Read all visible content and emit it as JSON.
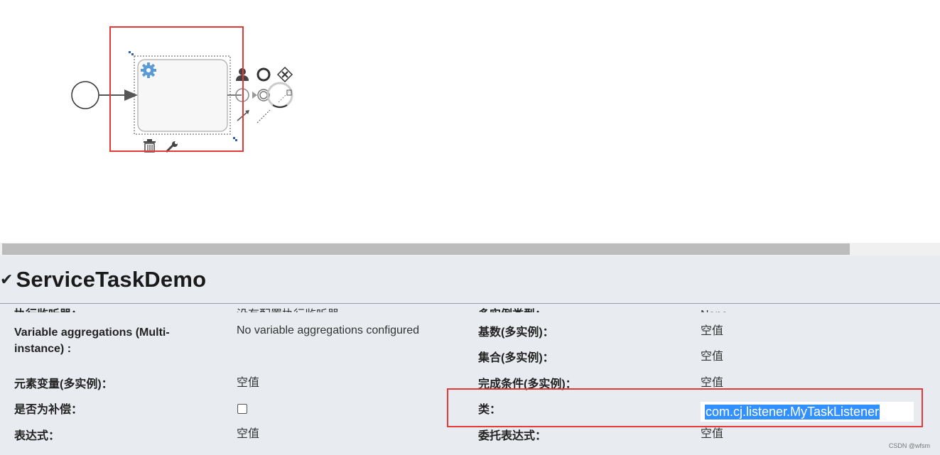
{
  "colors": {
    "highlight_box": "#e53935",
    "selection": "#3390ff",
    "gear": "#5b9bd5"
  },
  "diagram": {
    "icons": [
      "start-event-icon",
      "sequence-arrow-icon",
      "service-task-icon",
      "gear-icon",
      "user-task-icon",
      "end-event-icon",
      "gateway-icon",
      "intermediate-event-icon",
      "connector-icon",
      "annotation-icon",
      "delete-icon",
      "wrench-icon"
    ]
  },
  "panel": {
    "title": "ServiceTaskDemo",
    "left": [
      {
        "label": "执行监听器：",
        "value": "没有配置执行监听器"
      },
      {
        "label": "Variable aggregations (Multi-instance) :",
        "value": "No variable aggregations configured"
      },
      {
        "label": "元素变量(多实例)：",
        "value": "空值"
      },
      {
        "label": "是否为补偿：",
        "value": ""
      },
      {
        "label": "表达式：",
        "value": "空值"
      }
    ],
    "right": [
      {
        "label": "多实例类型：",
        "value": "None"
      },
      {
        "label": "基数(多实例)：",
        "value": "空值"
      },
      {
        "label": "集合(多实例)：",
        "value": "空值"
      },
      {
        "label": "完成条件(多实例)：",
        "value": "空值"
      },
      {
        "label": "类：",
        "value": "com.cj.listener.MyTaskListener"
      },
      {
        "label": "委托表达式：",
        "value": "空值"
      }
    ]
  },
  "watermark": "CSDN @wfsm"
}
